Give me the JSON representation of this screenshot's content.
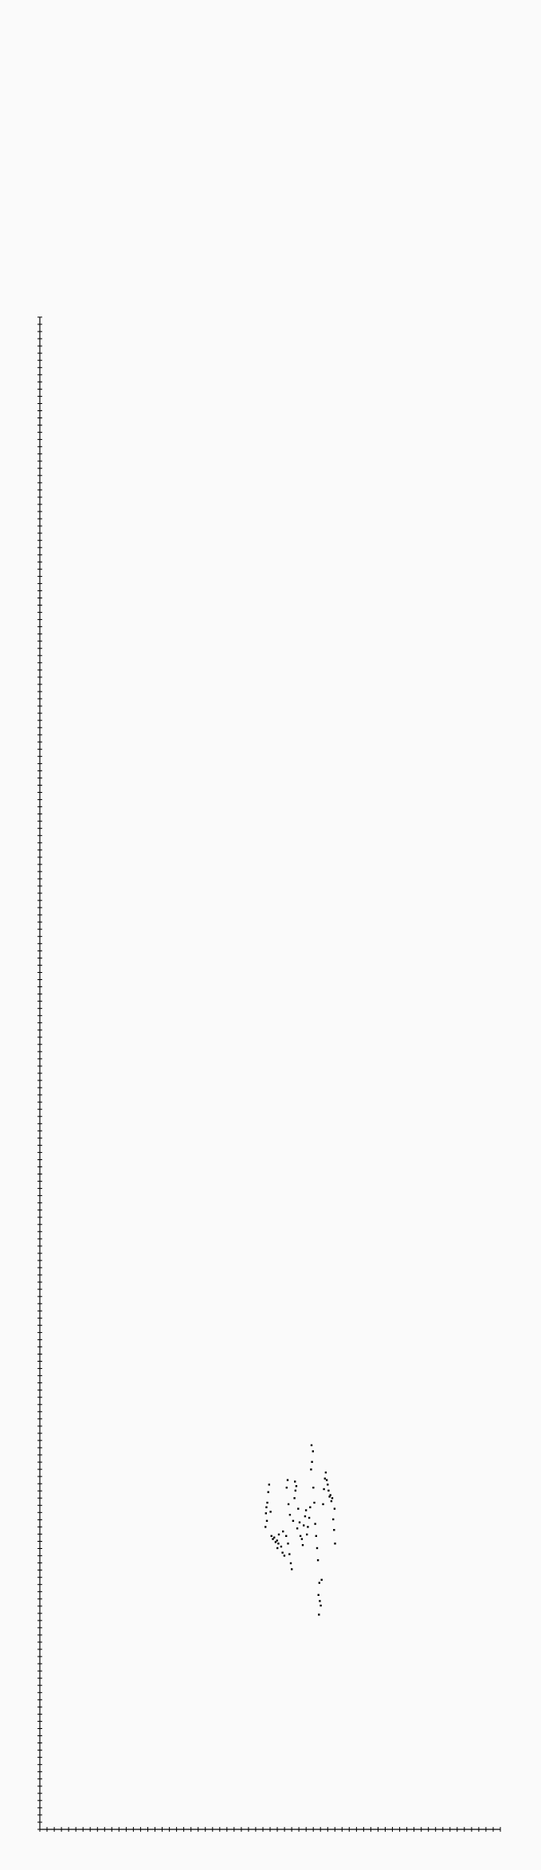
{
  "chart_data": {
    "type": "scatter",
    "title": "",
    "xlabel": "",
    "ylabel": "",
    "xlim": [
      0,
      100
    ],
    "ylim": [
      0,
      100
    ],
    "grid": false,
    "legend": "none",
    "tick_labels": false,
    "minor_ticks": {
      "x_count": 64,
      "y_count": 210
    },
    "series": [
      {
        "color": "#000000",
        "points": [
          [
            49.8,
            22.8
          ],
          [
            49.6,
            22.3
          ],
          [
            49.4,
            21.6
          ],
          [
            49.2,
            21.3
          ],
          [
            49.1,
            20.9
          ],
          [
            49.3,
            20.4
          ],
          [
            49.0,
            20.0
          ],
          [
            50.1,
            21.0
          ],
          [
            50.3,
            19.4
          ],
          [
            50.6,
            19.2
          ],
          [
            50.9,
            19.3
          ],
          [
            51.2,
            19.0
          ],
          [
            51.5,
            19.1
          ],
          [
            51.8,
            18.9
          ],
          [
            51.6,
            18.6
          ],
          [
            51.9,
            19.5
          ],
          [
            52.4,
            18.7
          ],
          [
            52.7,
            18.3
          ],
          [
            53.1,
            18.1
          ],
          [
            52.8,
            19.7
          ],
          [
            53.5,
            19.4
          ],
          [
            53.9,
            18.9
          ],
          [
            54.2,
            18.2
          ],
          [
            54.5,
            17.6
          ],
          [
            54.7,
            17.2
          ],
          [
            53.6,
            22.6
          ],
          [
            53.8,
            23.1
          ],
          [
            54.0,
            21.5
          ],
          [
            54.3,
            20.8
          ],
          [
            55.0,
            20.4
          ],
          [
            55.3,
            21.9
          ],
          [
            55.5,
            22.4
          ],
          [
            55.7,
            22.7
          ],
          [
            55.4,
            23.0
          ],
          [
            56.1,
            21.2
          ],
          [
            55.9,
            19.9
          ],
          [
            56.4,
            20.3
          ],
          [
            56.6,
            19.4
          ],
          [
            56.9,
            19.2
          ],
          [
            57.1,
            18.8
          ],
          [
            57.3,
            20.1
          ],
          [
            57.6,
            20.7
          ],
          [
            57.8,
            21.1
          ],
          [
            58.0,
            19.5
          ],
          [
            58.2,
            20.0
          ],
          [
            58.5,
            20.6
          ],
          [
            58.7,
            21.3
          ],
          [
            58.9,
            23.8
          ],
          [
            59.1,
            24.3
          ],
          [
            59.3,
            25.0
          ],
          [
            59.0,
            25.4
          ],
          [
            59.4,
            22.6
          ],
          [
            59.6,
            21.6
          ],
          [
            59.8,
            20.2
          ],
          [
            60.0,
            19.4
          ],
          [
            60.2,
            18.6
          ],
          [
            60.4,
            17.8
          ],
          [
            60.7,
            16.3
          ],
          [
            60.5,
            15.5
          ],
          [
            60.8,
            15.1
          ],
          [
            61.0,
            14.8
          ],
          [
            60.6,
            14.2
          ],
          [
            61.2,
            16.5
          ],
          [
            61.5,
            21.5
          ],
          [
            61.7,
            22.5
          ],
          [
            61.9,
            23.2
          ],
          [
            62.1,
            23.6
          ],
          [
            62.3,
            23.1
          ],
          [
            62.5,
            22.8
          ],
          [
            62.7,
            22.4
          ],
          [
            62.9,
            22.0
          ],
          [
            63.1,
            22.1
          ],
          [
            63.3,
            21.7
          ],
          [
            63.5,
            21.9
          ],
          [
            63.7,
            20.5
          ],
          [
            63.9,
            19.8
          ],
          [
            64.1,
            18.9
          ],
          [
            64.0,
            21.2
          ]
        ]
      }
    ]
  }
}
